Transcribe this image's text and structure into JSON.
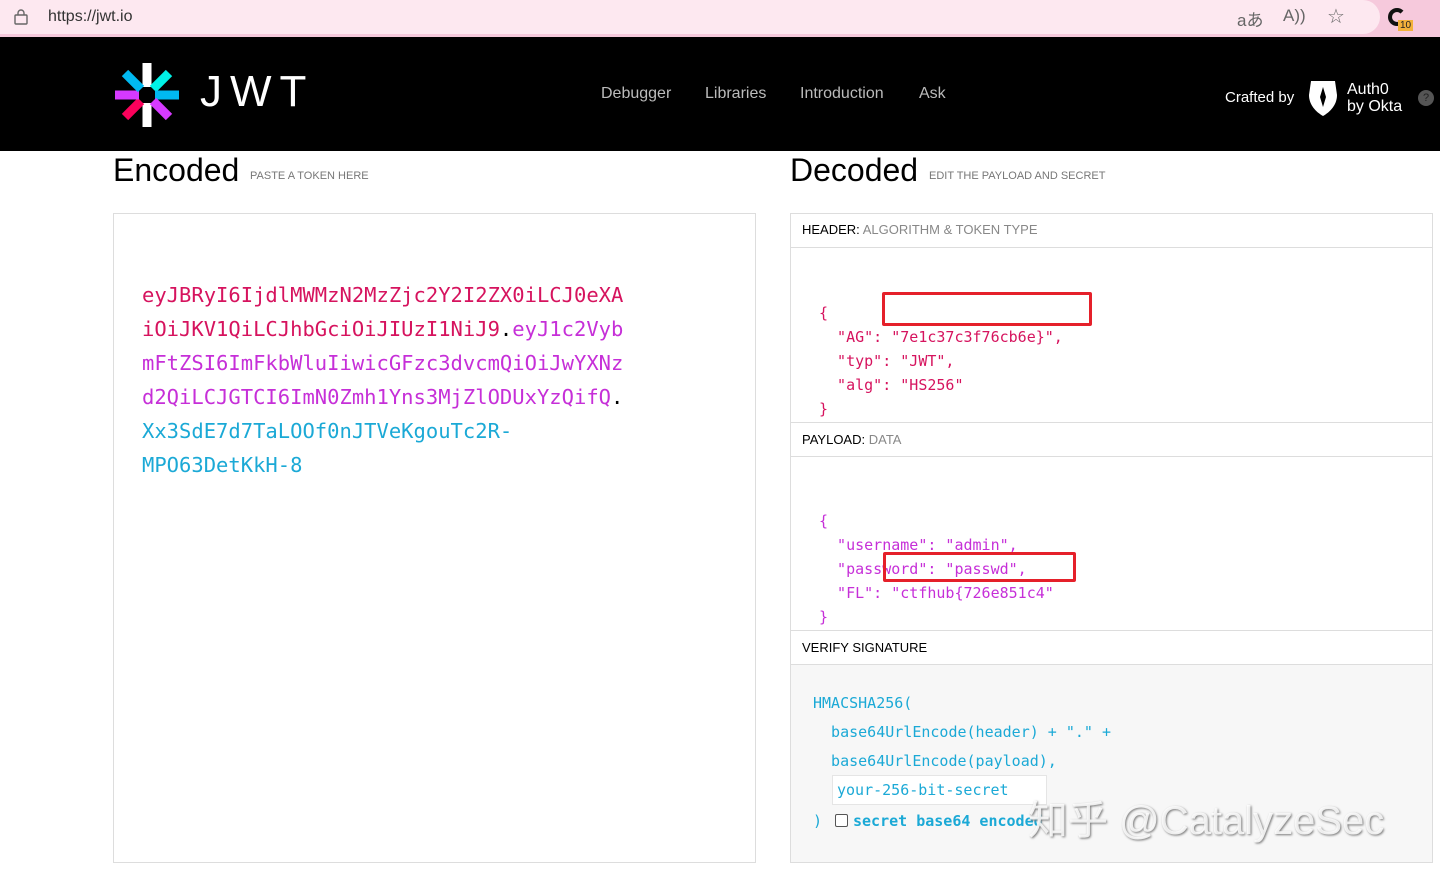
{
  "browser": {
    "url": "https://jwt.io",
    "translate_icon": "aあ",
    "read_aloud_icon": "A))",
    "extension_badge": "10"
  },
  "nav": {
    "logo_text": "JWT",
    "items": [
      "Debugger",
      "Libraries",
      "Introduction",
      "Ask"
    ],
    "crafted_by": "Crafted by",
    "brand_line1": "Auth0",
    "brand_line2": "by Okta",
    "help": "?"
  },
  "encoded": {
    "title": "Encoded",
    "subtitle": "PASTE A TOKEN HERE",
    "token_header_l1": "eyJBRyI6IjdlMWMzN2MzZjc2Y2I2ZX0iLCJ0eXA",
    "token_header_l2": "iOiJKV1QiLCJhbGciOiJIUzI1NiJ9",
    "token_payload_l2": "eyJ1c2Vyb",
    "token_payload_l3": "mFtZSI6ImFkbWluIiwicGFzc3dvcmQiOiJwYXNz",
    "token_payload_l4": "d2QiLCJGTCI6ImN0Zmh1Yns3MjZlODUxYzQifQ",
    "token_sig_l5": "Xx3SdE7d7TaLOOf0nJTVeKgouTc2R-",
    "token_sig_l6": "MPO63DetKkH-8",
    "dot": "."
  },
  "decoded": {
    "title": "Decoded",
    "subtitle": "EDIT THE PAYLOAD AND SECRET",
    "header_label": "HEADER:",
    "header_sub": "ALGORITHM & TOKEN TYPE",
    "header_lines": [
      "{",
      "  \"AG\": \"7e1c37c3f76cb6e}\",",
      "  \"typ\": \"JWT\",",
      "  \"alg\": \"HS256\"",
      "}"
    ],
    "payload_label": "PAYLOAD:",
    "payload_sub": "DATA",
    "payload_lines": [
      "{",
      "  \"username\": \"admin\",",
      "  \"password\": \"passwd\",",
      "  \"FL\": \"ctfhub{726e851c4\"",
      "}"
    ],
    "verify_label": "VERIFY SIGNATURE",
    "verify_lines": [
      "HMACSHA256(",
      "  base64UrlEncode(header) + \".\" +",
      "  base64UrlEncode(payload),"
    ],
    "secret_placeholder": "your-256-bit-secret",
    "close_paren": ")",
    "checkbox_label": "secret base64 encoded"
  },
  "watermark": "知乎 @CatalyzeSec"
}
